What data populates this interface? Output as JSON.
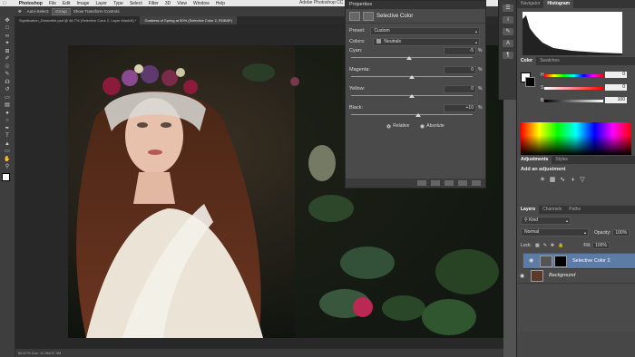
{
  "menubar": {
    "app": "Photoshop",
    "items": [
      "File",
      "Edit",
      "Image",
      "Layer",
      "Type",
      "Select",
      "Filter",
      "3D",
      "View",
      "Window",
      "Help"
    ],
    "window_title": "Adobe Photoshop CC 2014"
  },
  "options_bar": {
    "auto_select": "Auto-Select:",
    "group": "Group",
    "transform": "Show Transform Controls"
  },
  "doc_tabs": [
    {
      "label": "Signification_Dreamfire.psd @ 66.7% (Selective Color 2, Layer Mask/8) *"
    },
    {
      "label": "Goddess of Spring at 50% (Selective Color 2, RGB/8*)"
    }
  ],
  "status_text": "66.67%  Doc: 10.5M/37.3M",
  "properties": {
    "header": "Properties",
    "title": "Selective Color",
    "preset_label": "Preset:",
    "preset_value": "Custom",
    "colors_label": "Colors:",
    "colors_value": "Neutrals",
    "sliders": [
      {
        "label": "Cyan:",
        "value": "-5",
        "fraction": 0.475
      },
      {
        "label": "Magenta:",
        "value": "0",
        "fraction": 0.5
      },
      {
        "label": "Yellow:",
        "value": "0",
        "fraction": 0.5
      },
      {
        "label": "Black:",
        "value": "+10",
        "fraction": 0.55
      }
    ],
    "percent": "%",
    "method_relative": "Relative",
    "method_absolute": "Absolute"
  },
  "dock": {
    "navigator_tab": "Navigator",
    "histogram_tab": "Histogram",
    "color_tab": "Color",
    "swatches_tab": "Swatches",
    "hue_label": "H",
    "sat_label": "S",
    "bri_label": "B",
    "hue_value": "0",
    "sat_value": "0",
    "bri_value": "100",
    "adjustments_tab": "Adjustments",
    "styles_tab": "Styles",
    "add_adjustment": "Add an adjustment",
    "layers_tab": "Layers",
    "channels_tab": "Channels",
    "paths_tab": "Paths",
    "kind_filter": "Kind",
    "blend_mode": "Normal",
    "opacity_label": "Opacity:",
    "opacity_value": "100%",
    "lock_label": "Lock:",
    "fill_label": "Fill:",
    "fill_value": "100%",
    "layers": [
      {
        "name": "Selective Color 2",
        "selected": true
      },
      {
        "name": "Background",
        "selected": false
      }
    ]
  }
}
